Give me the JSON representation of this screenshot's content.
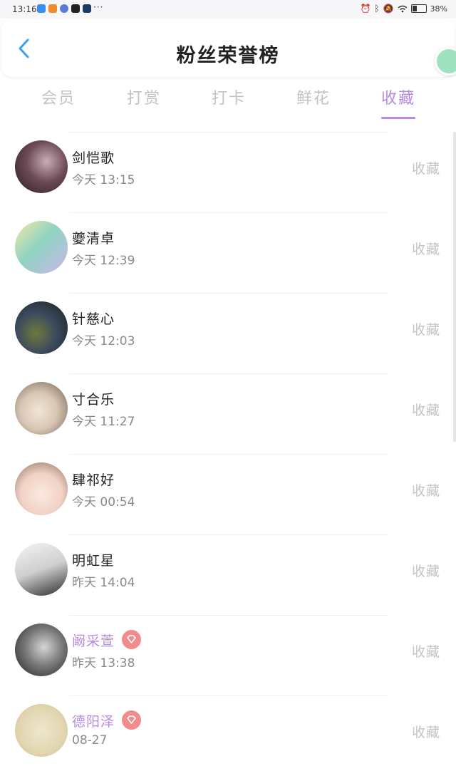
{
  "status_bar": {
    "time": "13:16",
    "more": "···",
    "battery": "38%",
    "battery_level": 0.38
  },
  "header": {
    "title": "粉丝荣誉榜"
  },
  "tabs": [
    {
      "label": "会员",
      "active": false
    },
    {
      "label": "打赏",
      "active": false
    },
    {
      "label": "打卡",
      "active": false
    },
    {
      "label": "鲜花",
      "active": false
    },
    {
      "label": "收藏",
      "active": true
    }
  ],
  "colors": {
    "accent": "#b68be0",
    "vip_badge": "#f28b8b",
    "muted": "#c4c4c4"
  },
  "list": [
    {
      "name": "剑恺歌",
      "time": "今天 13:15",
      "action": "收藏",
      "vip": false
    },
    {
      "name": "夔清卓",
      "time": "今天 12:39",
      "action": "收藏",
      "vip": false
    },
    {
      "name": "针慈心",
      "time": "今天 12:03",
      "action": "收藏",
      "vip": false
    },
    {
      "name": "寸合乐",
      "time": "今天 11:27",
      "action": "收藏",
      "vip": false
    },
    {
      "name": "肆祁好",
      "time": "今天 00:54",
      "action": "收藏",
      "vip": false
    },
    {
      "name": "明虹星",
      "time": "昨天 14:04",
      "action": "收藏",
      "vip": false
    },
    {
      "name": "阚采萱",
      "time": "昨天 13:38",
      "action": "收藏",
      "vip": true
    },
    {
      "name": "德阳泽",
      "time": "08-27",
      "action": "收藏",
      "vip": true
    }
  ]
}
